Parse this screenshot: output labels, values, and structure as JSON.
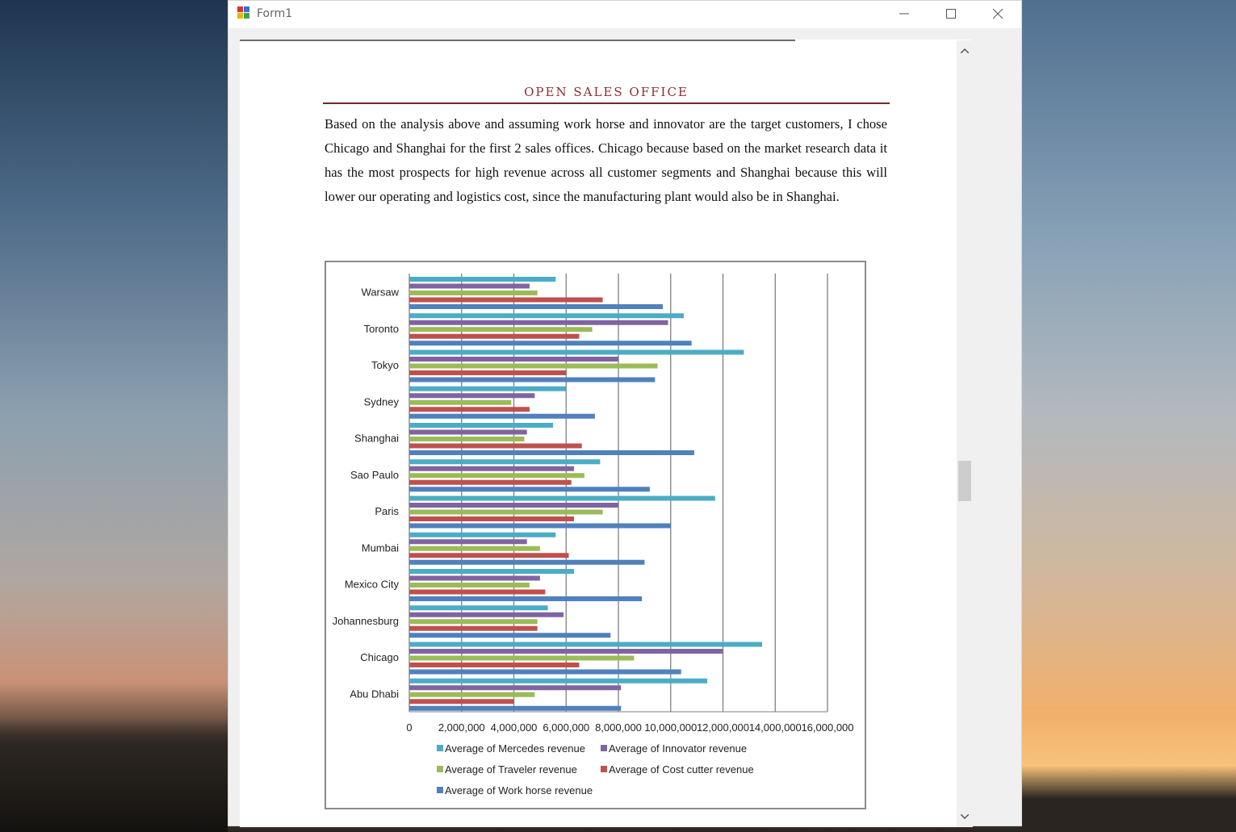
{
  "window": {
    "title": "Form1",
    "minimize_glyph": "─",
    "maximize_glyph": "☐",
    "close_glyph": "✕"
  },
  "scrollbar": {
    "up_glyph": "⌃",
    "down_glyph": "⌄"
  },
  "document": {
    "heading": "OPEN SALES OFFICE",
    "paragraph": "Based on the analysis above and assuming work horse and innovator are the target customers, I chose Chicago and Shanghai for the first 2 sales offices. Chicago because based on the market research data it has the most prospects for high revenue across all customer segments and Shanghai because this will lower our operating and logistics cost, since the manufacturing plant would also be in Shanghai."
  },
  "colors": {
    "Mercedes": "#4bacc6",
    "Innovator": "#8064a2",
    "Traveler": "#9bbb59",
    "Costcutter": "#c0504d",
    "Workhorse": "#4f81bd"
  },
  "chart_data": {
    "type": "bar",
    "orientation": "horizontal",
    "categories": [
      "Warsaw",
      "Toronto",
      "Tokyo",
      "Sydney",
      "Shanghai",
      "Sao Paulo",
      "Paris",
      "Mumbai",
      "Mexico City",
      "Johannesburg",
      "Chicago",
      "Abu Dhabi"
    ],
    "xlim": [
      0,
      16000000
    ],
    "xticks": [
      "0",
      "2,000,000",
      "4,000,000",
      "6,000,000",
      "8,000,000",
      "10,000,000",
      "12,000,000",
      "14,000,000",
      "16,000,000"
    ],
    "grid": true,
    "legend": "bottom",
    "series": [
      {
        "name": "Average of Mercedes revenue",
        "key": "Mercedes",
        "values": [
          5600000,
          10500000,
          12800000,
          6000000,
          5500000,
          7300000,
          11700000,
          5600000,
          6300000,
          5300000,
          13500000,
          11400000
        ]
      },
      {
        "name": "Average of Innovator revenue",
        "key": "Innovator",
        "values": [
          4600000,
          9900000,
          8000000,
          4800000,
          4500000,
          6300000,
          8000000,
          4500000,
          5000000,
          5900000,
          12000000,
          8100000
        ]
      },
      {
        "name": "Average of Traveler revenue",
        "key": "Traveler",
        "values": [
          4900000,
          7000000,
          9500000,
          3900000,
          4400000,
          6700000,
          7400000,
          5000000,
          4600000,
          4900000,
          8600000,
          4800000
        ]
      },
      {
        "name": "Average of Cost cutter revenue",
        "key": "Costcutter",
        "values": [
          7400000,
          6500000,
          6000000,
          4600000,
          6600000,
          6200000,
          6300000,
          6100000,
          5200000,
          4900000,
          6500000,
          4000000
        ]
      },
      {
        "name": "Average of Work horse revenue",
        "key": "Workhorse",
        "values": [
          9700000,
          10800000,
          9400000,
          7100000,
          10900000,
          9200000,
          10000000,
          9000000,
          8900000,
          7700000,
          10400000,
          8100000
        ]
      }
    ]
  }
}
